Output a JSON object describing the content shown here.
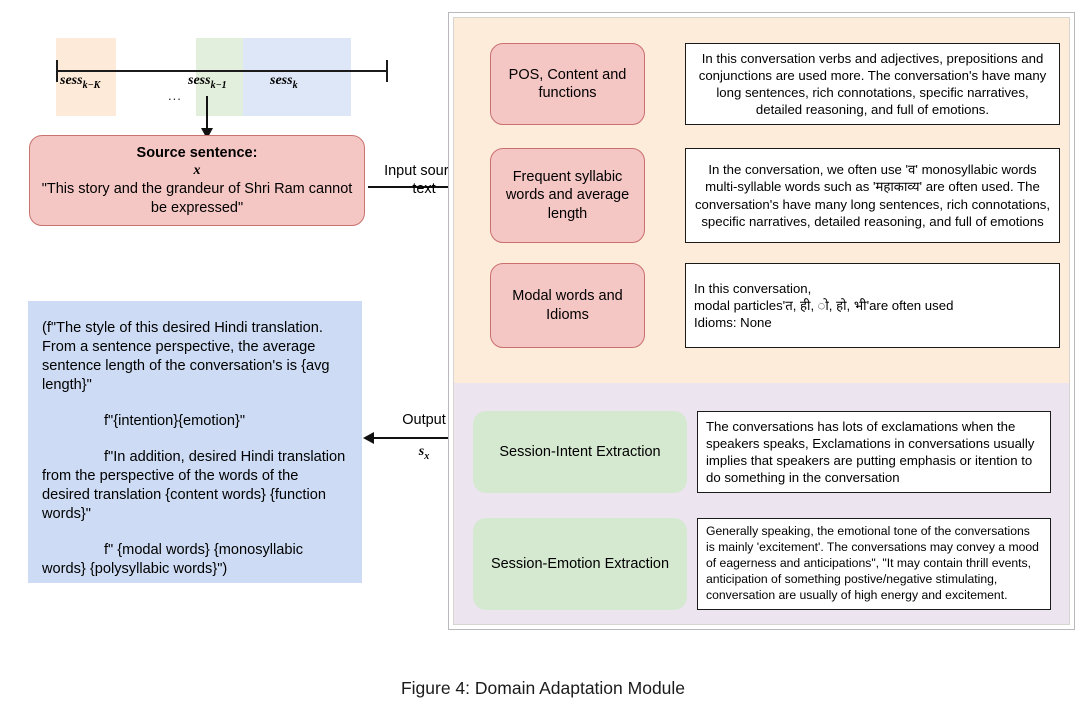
{
  "figure": {
    "caption": "Figure 4: Domain Adaptation Module"
  },
  "timeline": {
    "session_far": "sess",
    "session_far_sub": "k−K",
    "session_prev": "sess",
    "session_prev_sub": "k−1",
    "session_cur": "sess",
    "session_cur_sub": "k",
    "ellipsis": "...",
    "band_colors": {
      "far": "#fdead8",
      "prev": "#e2efdc",
      "current": "#dde7f7"
    }
  },
  "source": {
    "title": "Source sentence:",
    "variable": "x",
    "sentence": "\"This story and the grandeur of Shri Ram cannot be expressed\"",
    "fill": "#f5c7c4",
    "stroke": "#c8736f"
  },
  "edges": {
    "input_line1": "Input source",
    "input_line2": "text",
    "output_label": "Output",
    "output_symbol": "s",
    "output_symbol_sub": "x"
  },
  "prompt": {
    "fill": "#cddcf4",
    "lines": [
      "(f\"The style of this desired Hindi translation. From a sentence perspective, the average sentence length of the conversation's is {avg length}\"",
      "f\"{intention}{emotion}\"",
      "f\"In addition, desired Hindi translation from the perspective of the words of the desired translation {content words} {function words}\"",
      "f\" {modal words} {monosyllabic words} {polysyllabic words}\")"
    ]
  },
  "panel": {
    "orange_band": "#fdecd9",
    "purple_band": "#ece4ef",
    "rows": [
      {
        "id": "pos",
        "tag": "POS, Content and functions",
        "tag_color": "#f4c6c4",
        "text": "In this conversation verbs and adjectives, prepositions and conjunctions are used more. The conversation's have many long sentences, rich connotations, specific narratives, detailed reasoning, and full of emotions."
      },
      {
        "id": "syllabic",
        "tag": "Frequent syllabic words and average length",
        "tag_color": "#f4c6c4",
        "text": "In the conversation, we often use 'व' monosyllabic words multi-syllable words such as 'महाकाव्य' are often used. The conversation's have many long sentences, rich connotations, specific narratives, detailed reasoning, and full of emotions"
      },
      {
        "id": "modal",
        "tag": "Modal words and Idioms",
        "tag_color": "#f4c6c4",
        "text": "In this conversation,\nmodal particles'त, ही, ो, हो, भी'are often used\nIdioms: None"
      },
      {
        "id": "intent",
        "tag": "Session-Intent Extraction",
        "tag_color": "#d5e8d0",
        "text": "The conversations has lots of exclamations when the speakers speaks, Exclamations in conversations usually implies that speakers are putting emphasis or itention to do something in the conversation"
      },
      {
        "id": "emotion",
        "tag": "Session-Emotion Extraction",
        "tag_color": "#d5e8d0",
        "text": "Generally speaking, the emotional tone of the conversations is mainly 'excitement'. The conversations may convey a mood of eagerness and anticipations\", \"It may contain thrill events, anticipation of something postive/negative stimulating, conversation are usually of high energy and excitement."
      }
    ]
  }
}
